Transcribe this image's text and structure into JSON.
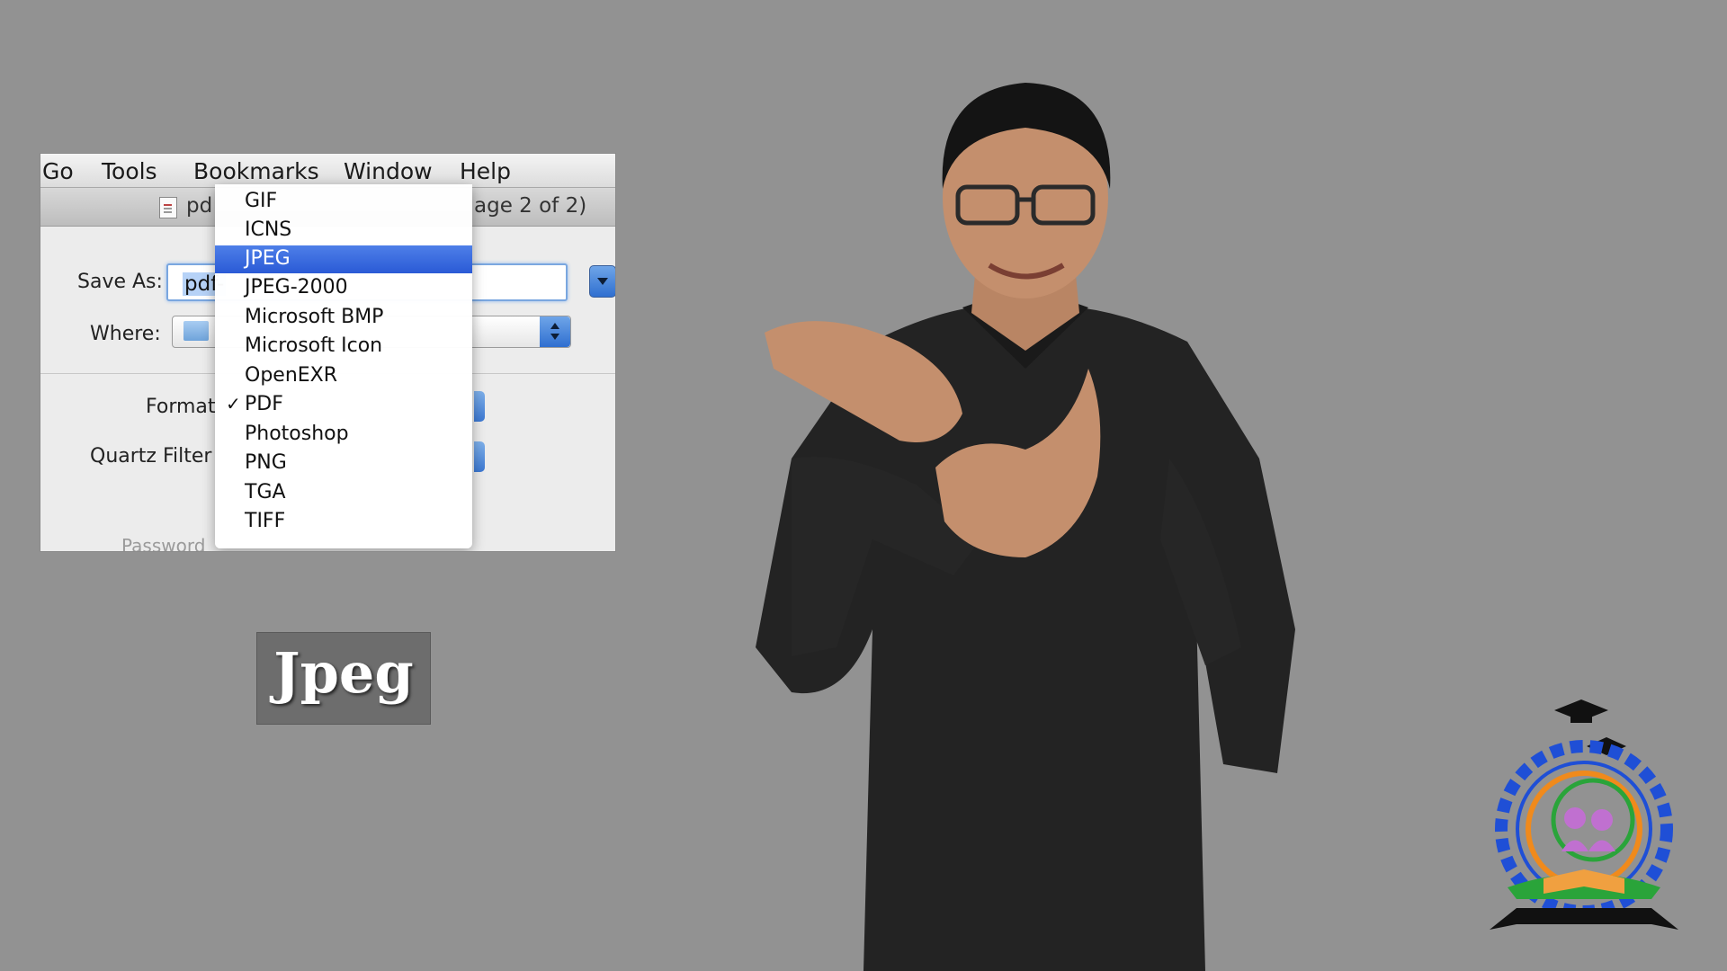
{
  "menubar": {
    "items": [
      "Go",
      "Tools",
      "Bookmarks",
      "Window",
      "Help"
    ]
  },
  "window": {
    "title_left": "pd",
    "title_right": "age 2 of 2)"
  },
  "save_dialog": {
    "save_as_label": "Save As:",
    "save_as_value": "pdf-",
    "where_label": "Where:",
    "format_label": "Format",
    "quartz_filter_label": "Quartz Filter",
    "password_label": "Password"
  },
  "format_menu": {
    "items": [
      {
        "label": "GIF"
      },
      {
        "label": "ICNS"
      },
      {
        "label": "JPEG",
        "highlighted": true
      },
      {
        "label": "JPEG-2000"
      },
      {
        "label": "Microsoft BMP"
      },
      {
        "label": "Microsoft Icon"
      },
      {
        "label": "OpenEXR"
      },
      {
        "label": "PDF",
        "checked": true,
        "check_mark": "✓"
      },
      {
        "label": "Photoshop"
      },
      {
        "label": "PNG"
      },
      {
        "label": "TGA"
      },
      {
        "label": "TIFF"
      }
    ]
  },
  "caption": {
    "text": "Jpeg"
  },
  "colors": {
    "background": "#929292",
    "menu_highlight": "#2a5ad6",
    "caption_bg": "#6d6d6d",
    "shirt": "#232323",
    "emblem_blue": "#1f4fd6",
    "emblem_green": "#2aa43a",
    "emblem_orange": "#f08a1c"
  }
}
